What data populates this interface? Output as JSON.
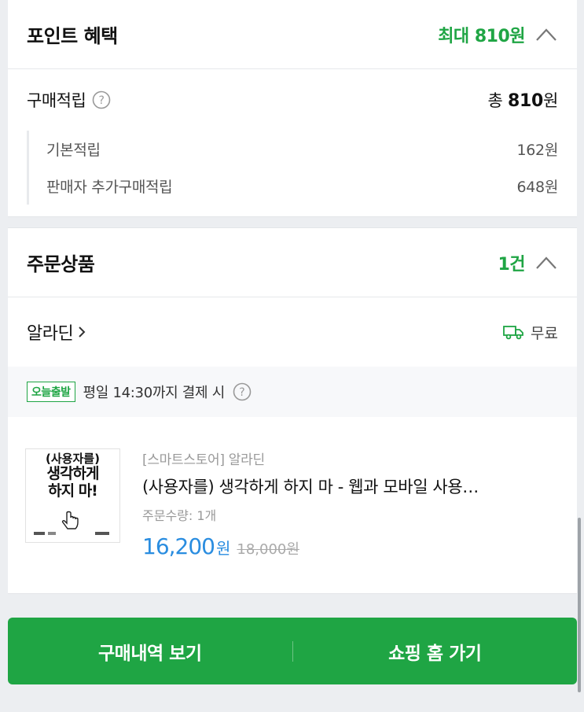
{
  "points": {
    "title": "포인트 혜택",
    "max_label": "최대 810원",
    "earn_label": "구매적립",
    "earn_total_prefix": "총",
    "earn_total_value": "810",
    "earn_total_unit": "원",
    "items": [
      {
        "label": "기본적립",
        "value": "162원"
      },
      {
        "label": "판매자 추가구매적립",
        "value": "648원"
      }
    ]
  },
  "order": {
    "title": "주문상품",
    "count_label": "1건",
    "seller": "알라딘",
    "shipping": "무료",
    "today_badge": "오늘출발",
    "today_text": "평일 14:30까지 결제 시",
    "product": {
      "thumb_line1": "(사용자를)",
      "thumb_line2": "생각하게",
      "thumb_line3": "하지 마!",
      "store": "[스마트스토어] 알라딘",
      "name": "(사용자를) 생각하게 하지 마 - 웹과 모바일 사용…",
      "qty": "주문수량: 1개",
      "sale_price": "16,200",
      "sale_unit": "원",
      "original_price": "18,000원"
    }
  },
  "actions": {
    "history_label": "구매내역 보기",
    "home_label": "쇼핑 홈 가기"
  },
  "colors": {
    "accent_green": "#1fa544",
    "price_blue": "#2a8de0"
  },
  "icons": [
    "question-icon",
    "chevron-up-icon",
    "chevron-right-icon",
    "truck-icon",
    "hand-cursor-icon"
  ]
}
